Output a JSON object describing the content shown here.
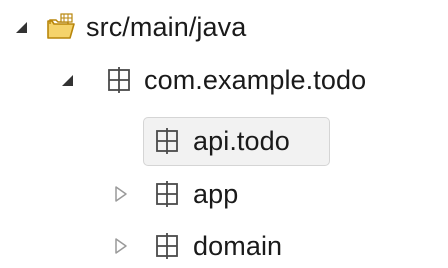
{
  "tree": {
    "items": [
      {
        "label": "src/main/java",
        "expanded": true,
        "icon": "source-folder-icon"
      },
      {
        "label": "com.example.todo",
        "expanded": true,
        "icon": "package-icon"
      },
      {
        "label": "api.todo",
        "selected": true,
        "icon": "package-icon"
      },
      {
        "label": "app",
        "expanded": false,
        "icon": "package-icon"
      },
      {
        "label": "domain",
        "expanded": false,
        "icon": "package-icon"
      }
    ]
  },
  "colors": {
    "text": "#1a1a1a",
    "expanded_twisty": "#333333",
    "collapsed_twisty": "#9a9a9a",
    "folder_outline": "#b8860b",
    "folder_fill": "#f5d36b",
    "package_icon": "#4a4a4a",
    "selection_bg": "#f2f2f2",
    "selection_border": "#d5d5d5"
  }
}
